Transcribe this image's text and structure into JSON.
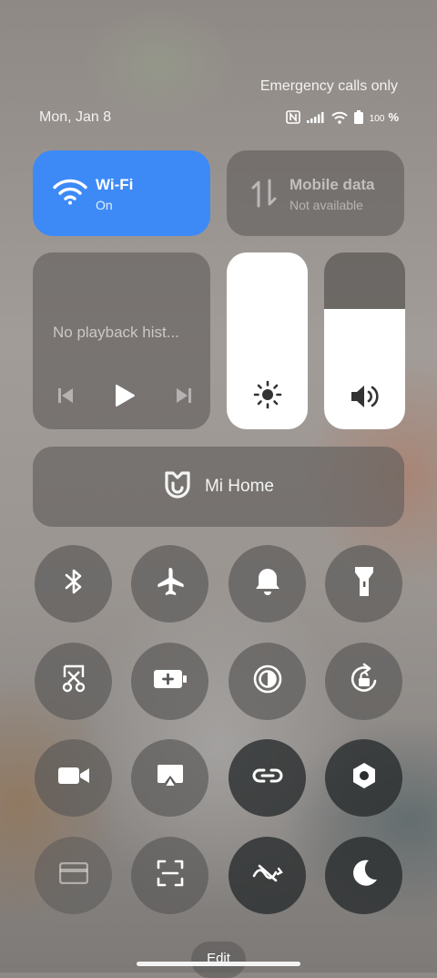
{
  "status": {
    "carrier_text": "Emergency calls only",
    "date": "Mon, Jan 8",
    "battery_text": "100",
    "battery_unit": "%"
  },
  "wifi": {
    "title": "Wi-Fi",
    "subtitle": "On",
    "icon": "wifi-icon",
    "color": "#3d8af7"
  },
  "mobile_data": {
    "title": "Mobile data",
    "subtitle": "Not available",
    "icon": "mobile-data-icon"
  },
  "media": {
    "status": "No playback hist..."
  },
  "brightness": {
    "level": 1.0,
    "icon": "sun-icon"
  },
  "volume": {
    "level": 0.68,
    "icon": "speaker-icon"
  },
  "mi_home": {
    "label": "Mi Home",
    "icon": "mi-home-icon"
  },
  "toggles": [
    "bluetooth-icon",
    "airplane-icon",
    "bell-icon",
    "flashlight-icon",
    "scissors-screenshot-icon",
    "battery-saver-icon",
    "reading-mode-icon",
    "rotation-lock-icon",
    "video-camera-icon",
    "cast-icon",
    "link-icon",
    "settings-hex-icon",
    "card-icon",
    "scan-icon",
    "mute-link-icon",
    "moon-icon"
  ],
  "footer": {
    "edit_label": "Edit"
  }
}
